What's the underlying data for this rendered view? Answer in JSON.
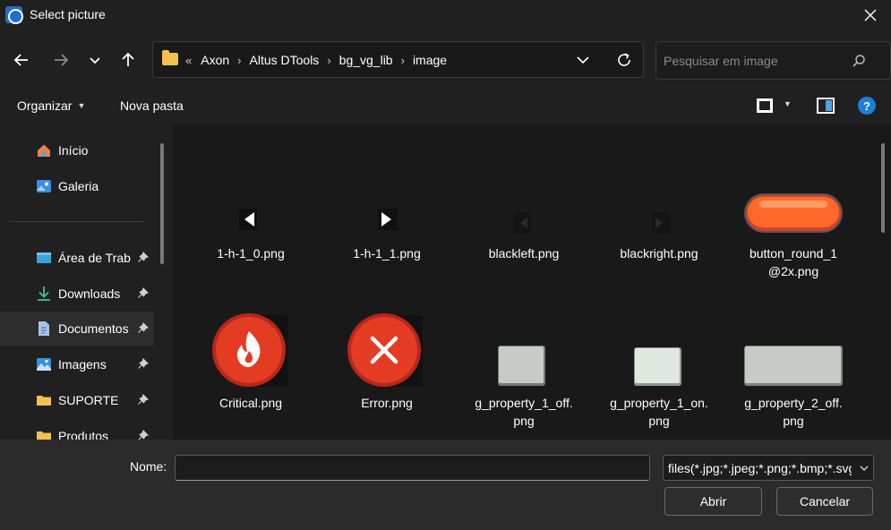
{
  "window": {
    "title": "Select picture"
  },
  "address": {
    "more_glyph": "«",
    "crumbs": [
      "Axon",
      "Altus DTools",
      "bg_vg_lib",
      "image"
    ]
  },
  "search": {
    "placeholder": "Pesquisar em image"
  },
  "toolbar": {
    "organize_label": "Organizar",
    "new_folder_label": "Nova pasta"
  },
  "sidebar": {
    "items": [
      {
        "label": "Início",
        "icon": "home-icon"
      },
      {
        "label": "Galeria",
        "icon": "gallery-icon"
      },
      {
        "label": "Área de Trab",
        "icon": "desktop-icon",
        "pinned": true
      },
      {
        "label": "Downloads",
        "icon": "download-icon",
        "pinned": true
      },
      {
        "label": "Documentos",
        "icon": "document-icon",
        "pinned": true,
        "selected": true
      },
      {
        "label": "Imagens",
        "icon": "pictures-icon",
        "pinned": true
      },
      {
        "label": "SUPORTE",
        "icon": "folder-icon",
        "pinned": true
      },
      {
        "label": "Produtos",
        "icon": "folder-icon",
        "pinned": true
      }
    ]
  },
  "files": [
    {
      "name": "1-h-1_0.png",
      "thumb": "arrow-left-white"
    },
    {
      "name": "1-h-1_1.png",
      "thumb": "arrow-right-white"
    },
    {
      "name": "blackleft.png",
      "thumb": "arrow-left-dark"
    },
    {
      "name": "blackright.png",
      "thumb": "arrow-right-dark"
    },
    {
      "name": "button_round_1@2x.png",
      "name_line1": "button_round_1",
      "name_line2": "@2x.png",
      "thumb": "orange-pill-button"
    },
    {
      "name": "Critical.png",
      "thumb": "critical-flame"
    },
    {
      "name": "Error.png",
      "thumb": "error-x"
    },
    {
      "name": "g_property_1_off.png",
      "name_line1": "g_property_1_off.",
      "name_line2": "png",
      "thumb": "gray-box-small"
    },
    {
      "name": "g_property_1_on.png",
      "name_line1": "g_property_1_on.",
      "name_line2": "png",
      "thumb": "light-box-small"
    },
    {
      "name": "g_property_2_off.png",
      "name_line1": "g_property_2_off.",
      "name_line2": "png",
      "thumb": "gray-box-wide"
    }
  ],
  "footer": {
    "name_label": "Nome:",
    "name_value": "",
    "filter_value": "files(*.jpg;*.jpeg;*.png;*.bmp;*.svg)",
    "open_label": "Abrir",
    "cancel_label": "Cancelar"
  },
  "colors": {
    "background": "#202020",
    "content": "#191919",
    "footer": "#2b2b2b",
    "accent": "#1e7fd8"
  }
}
